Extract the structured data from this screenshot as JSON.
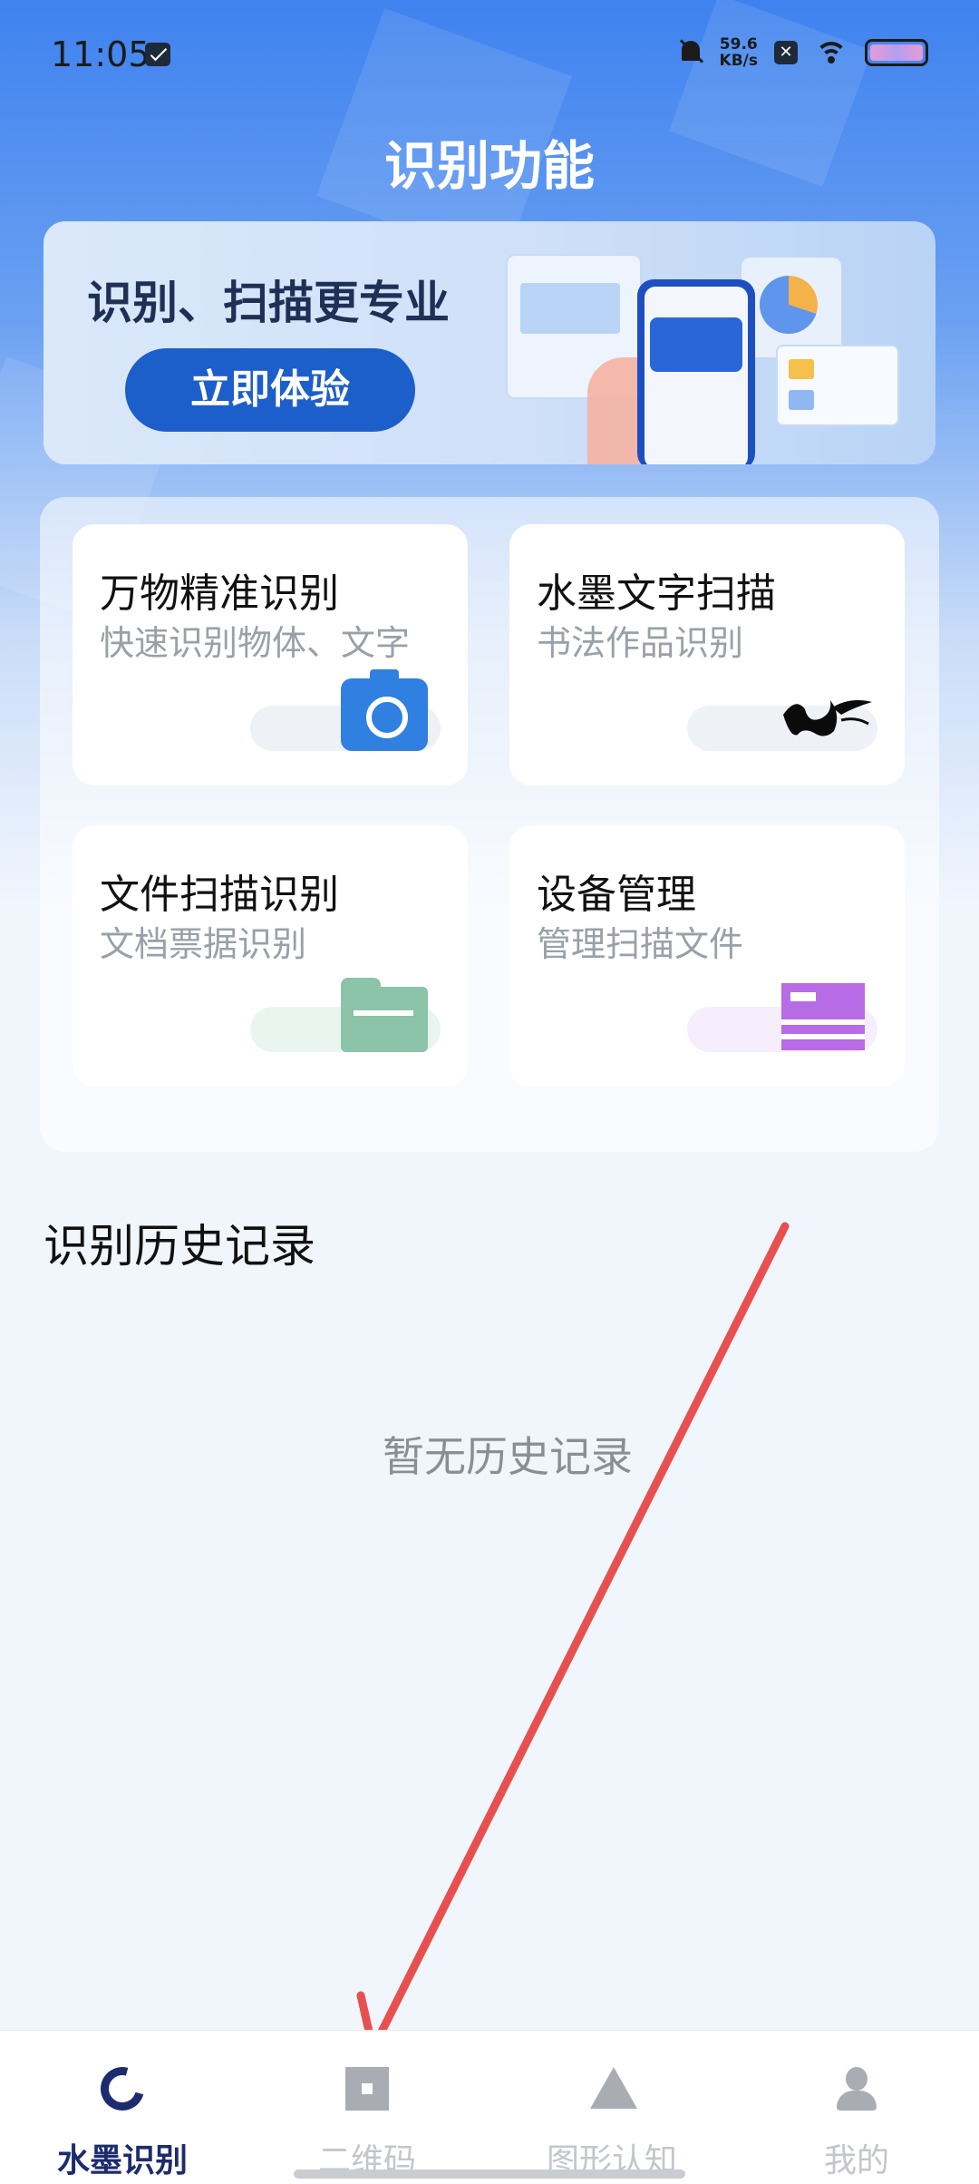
{
  "status_bar": {
    "time": "11:05",
    "net_speed_value": "59.6",
    "net_speed_unit": "KB/s",
    "x_badge": "✕"
  },
  "page": {
    "title": "识别功能"
  },
  "banner": {
    "title": "识别、扫描更专业",
    "button_label": "立即体验"
  },
  "features": [
    {
      "title": "万物精准识别",
      "subtitle": "快速识别物体、文字",
      "icon": "camera-icon",
      "pill_color": "#eef1f5"
    },
    {
      "title": "水墨文字扫描",
      "subtitle": "书法作品识别",
      "icon": "ink-brush-icon",
      "pill_color": "#eef1f5"
    },
    {
      "title": "文件扫描识别",
      "subtitle": "文档票据识别",
      "icon": "folder-icon",
      "pill_color": "#eaf5ef"
    },
    {
      "title": "设备管理",
      "subtitle": "管理扫描文件",
      "icon": "device-manage-icon",
      "pill_color": "#f6eefc"
    }
  ],
  "history": {
    "title": "识别历史记录",
    "empty_text": "暂无历史记录"
  },
  "bottom_nav": [
    {
      "label": "水墨识别",
      "icon": "ring-logo-icon",
      "active": true
    },
    {
      "label": "二维码",
      "icon": "qr-code-icon",
      "active": false
    },
    {
      "label": "图形认知",
      "icon": "mountain-icon",
      "active": false
    },
    {
      "label": "我的",
      "icon": "user-icon",
      "active": false
    }
  ],
  "colors": {
    "accent": "#1c5fca",
    "nav_active": "#1d2c6e",
    "arrow": "#e8504f"
  }
}
